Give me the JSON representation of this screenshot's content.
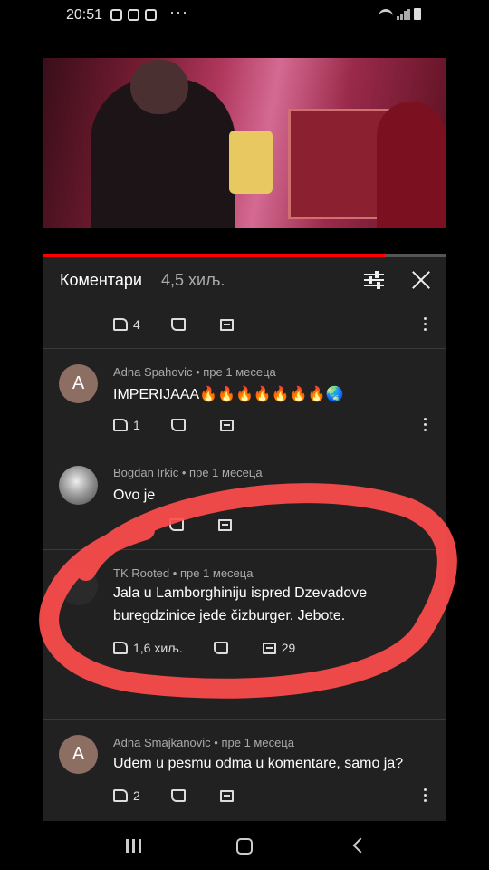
{
  "status": {
    "time": "20:51",
    "more": "···"
  },
  "comments_header": {
    "title": "Коментари",
    "count": "4,5 хиљ."
  },
  "top_row": {
    "likes": "4"
  },
  "comments": [
    {
      "avatar": "A",
      "author": "Adna Spahovic",
      "age": "пре 1 месеца",
      "text": "IMPERIJAAA🔥🔥🔥🔥🔥🔥🔥🌏",
      "likes": "1"
    },
    {
      "avatar": "",
      "author": "Bogdan Irkic",
      "age": "пре 1 месеца",
      "text": "Ovo je",
      "likes": ""
    },
    {
      "avatar": "",
      "author": "TK Rooted",
      "age": "пре 1 месеца",
      "text": "Jala u Lamborghiniju ispred Dzevadove buregdzinice jede čizburger. Jebote.",
      "likes": "1,6 хиљ.",
      "replies": "29"
    },
    {
      "avatar": "A",
      "author": "Adna Smajkanovic",
      "age": "пре 1 месеца",
      "text": "Udem u pesmu odma u komentare, samo ja?",
      "likes": "2"
    }
  ],
  "colors": {
    "panel": "#212121",
    "accent_red": "#ff0000",
    "scribble": "#ff4d4d"
  }
}
